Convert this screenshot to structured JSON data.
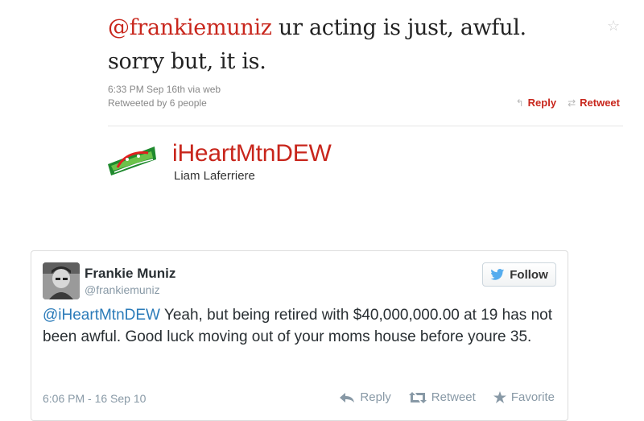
{
  "old_tweet": {
    "mention": "@frankiemuniz",
    "text_line1": " ur acting is just, awful.",
    "text_line2": "sorry but, it is.",
    "timestamp": "6:33 PM Sep 16th via web",
    "retweeted_by": "Retweeted by 6 people",
    "reply_label": "Reply",
    "retweet_label": "Retweet",
    "user_handle": "iHeartMtnDEW",
    "user_name": "Liam Laferriere",
    "brand_color": "#c8261c"
  },
  "embedded_tweet": {
    "name": "Frankie Muniz",
    "screen_name": "@frankiemuniz",
    "follow_label": "Follow",
    "mention": "@iHeartMtnDEW",
    "text": " Yeah, but being retired with $40,000,000.00 at 19 has not been awful. Good luck moving out of your moms house before youre 35.",
    "date": "6:06 PM - 16 Sep 10",
    "actions": {
      "reply": "Reply",
      "retweet": "Retweet",
      "favorite": "Favorite"
    },
    "link_color": "#2b7bb9",
    "twitter_blue": "#55acee"
  },
  "icons": [
    "star-icon",
    "reply-icon",
    "retweet-icon",
    "mtn-dew-logo",
    "twitter-bird-icon",
    "favorite-star-icon"
  ]
}
